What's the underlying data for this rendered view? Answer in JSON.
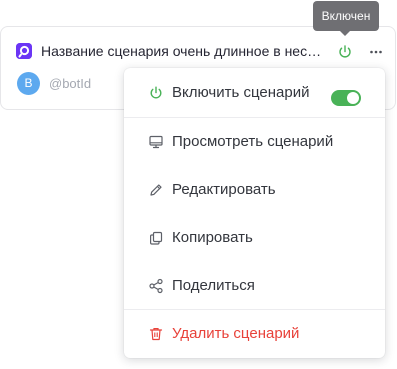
{
  "card": {
    "title": "Название сценария очень длинное в нескольких строках",
    "avatar_letter": "B",
    "bot_id": "@botId"
  },
  "tooltip": {
    "text": "Включен"
  },
  "menu": {
    "items": [
      {
        "label": "Включить сценарий",
        "icon": "power-icon"
      },
      {
        "label": "Просмотреть сценарий",
        "icon": "monitor-icon"
      },
      {
        "label": "Редактировать",
        "icon": "pencil-icon"
      },
      {
        "label": "Копировать",
        "icon": "copy-icon"
      },
      {
        "label": "Поделиться",
        "icon": "share-icon"
      },
      {
        "label": "Удалить сценарий",
        "icon": "trash-icon"
      }
    ],
    "toggle_on": true
  },
  "colors": {
    "accent_green": "#49b257",
    "danger_red": "#e8423a",
    "app_icon": "#6b35f5",
    "avatar": "#5da9ef",
    "tooltip_bg": "#6f6f73"
  }
}
